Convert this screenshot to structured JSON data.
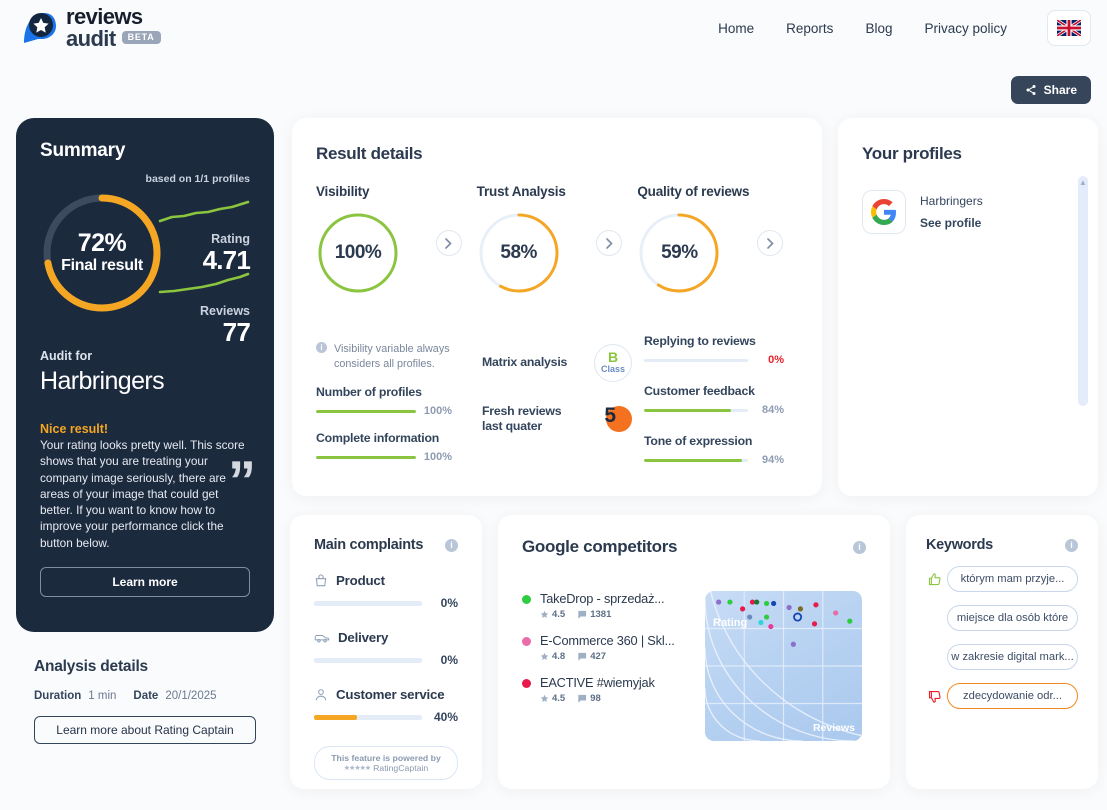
{
  "header": {
    "logo_line1": "reviews",
    "logo_line2": "audit",
    "beta": "BETA",
    "nav": [
      {
        "label": "Home"
      },
      {
        "label": "Reports"
      },
      {
        "label": "Blog"
      },
      {
        "label": "Privacy policy"
      }
    ],
    "language_icon": "uk-flag-icon",
    "share_label": "Share",
    "share_icon": "share-icon"
  },
  "summary": {
    "title": "Summary",
    "based_on": "based on 1/1 profiles",
    "final_percent": 72,
    "final_percent_label": "72%",
    "final_label": "Final result",
    "rating_label": "Rating",
    "rating_value": "4.71",
    "reviews_label": "Reviews",
    "reviews_value": "77",
    "audit_for_label": "Audit for",
    "audit_name": "Harbringers",
    "verdict_title": "Nice result!",
    "verdict_body": "Your rating looks pretty well. This score shows that you are treating your company image seriously, there are areas of your image that could get better. If you want to know how to improve your performance click the button below.",
    "learn_more": "Learn more",
    "accent": "#f5a623"
  },
  "analysis": {
    "title": "Analysis details",
    "duration_label": "Duration",
    "duration_value": "1 min",
    "date_label": "Date",
    "date_value": "20/1/2025",
    "rating_captain_btn": "Learn more about Rating Captain"
  },
  "result_details": {
    "title": "Result details",
    "metrics": [
      {
        "label": "Visibility",
        "value": 100,
        "value_label": "100%",
        "color": "#8bc53f"
      },
      {
        "label": "Trust Analysis",
        "value": 58,
        "value_label": "58%",
        "color": "#f5a623"
      },
      {
        "label": "Quality of reviews",
        "value": 59,
        "value_label": "59%",
        "color": "#f5a623"
      }
    ],
    "visibility_note": "Visibility variable always considers all profiles.",
    "visibility_bars": [
      {
        "label": "Number of profiles",
        "value": 100,
        "value_label": "100%",
        "color": "#8bc53f"
      },
      {
        "label": "Complete information",
        "value": 100,
        "value_label": "100%",
        "color": "#8bc53f"
      }
    ],
    "trust": {
      "matrix_label": "Matrix analysis",
      "matrix_grade": "B",
      "matrix_grade_sub": "Class",
      "fresh_label": "Fresh reviews last quater",
      "fresh_value": "5"
    },
    "quality_bars": [
      {
        "label": "Replying to reviews",
        "value": 0,
        "value_label": "0%",
        "color": "#e8202a",
        "red": true
      },
      {
        "label": "Customer feedback",
        "value": 84,
        "value_label": "84%",
        "color": "#8bc53f",
        "red": false
      },
      {
        "label": "Tone of expression",
        "value": 94,
        "value_label": "94%",
        "color": "#8bc53f",
        "red": false
      }
    ]
  },
  "profiles": {
    "title": "Your profiles",
    "items": [
      {
        "icon": "google-icon",
        "name": "Harbringers",
        "link": "See profile"
      }
    ]
  },
  "complaints": {
    "title": "Main complaints",
    "info_icon": "info-icon",
    "items": [
      {
        "icon": "basket-icon",
        "label": "Product",
        "value": 0,
        "value_label": "0%",
        "color": "#f5a623"
      },
      {
        "icon": "truck-icon",
        "label": "Delivery",
        "value": 0,
        "value_label": "0%",
        "color": "#f5a623"
      },
      {
        "icon": "person-icon",
        "label": "Customer service",
        "value": 40,
        "value_label": "40%",
        "color": "#f5a623"
      }
    ],
    "powered_line1": "This feature is powered by",
    "powered_stars": "★★★★★",
    "powered_brand": "RatingCaptain"
  },
  "competitors": {
    "title": "Google competitors",
    "info_icon": "info-icon",
    "items": [
      {
        "name": "TakeDrop - sprzedaż...",
        "rating": "4.5",
        "reviews": "1381",
        "color": "#2ecc40"
      },
      {
        "name": "E-Commerce 360 | Skl...",
        "rating": "4.8",
        "reviews": "427",
        "color": "#e86ca8"
      },
      {
        "name": "EACTIVE #wiemyjak",
        "rating": "4.5",
        "reviews": "98",
        "color": "#e8194b"
      }
    ],
    "axis_y": "Rating",
    "axis_x": "Reviews"
  },
  "chart_data": {
    "type": "scatter",
    "title": "Google competitors",
    "xlabel": "Reviews",
    "ylabel": "Rating",
    "xlim": [
      0,
      100
    ],
    "ylim": [
      0,
      100
    ],
    "grid": true,
    "points": [
      {
        "x": 4,
        "y": 97,
        "color": "#8e6ecb"
      },
      {
        "x": 12,
        "y": 97,
        "color": "#2ecc40"
      },
      {
        "x": 21,
        "y": 92,
        "color": "#e8194b"
      },
      {
        "x": 28,
        "y": 97,
        "color": "#e8194b"
      },
      {
        "x": 31,
        "y": 97,
        "color": "#1a7a2e"
      },
      {
        "x": 38,
        "y": 96,
        "color": "#2ecc40"
      },
      {
        "x": 43,
        "y": 96,
        "color": "#1744b5"
      },
      {
        "x": 54,
        "y": 93,
        "color": "#8e6ecb"
      },
      {
        "x": 62,
        "y": 92,
        "color": "#7a6a22"
      },
      {
        "x": 73,
        "y": 95,
        "color": "#e8194b"
      },
      {
        "x": 26,
        "y": 86,
        "color": "#6b8bbf"
      },
      {
        "x": 38,
        "y": 86,
        "color": "#2ecc40"
      },
      {
        "x": 34,
        "y": 82,
        "color": "#2fd6d6"
      },
      {
        "x": 41,
        "y": 79,
        "color": "#e8399b"
      },
      {
        "x": 72,
        "y": 81,
        "color": "#e8194b"
      },
      {
        "x": 60,
        "y": 86,
        "color": "#ffffff"
      },
      {
        "x": 87,
        "y": 89,
        "color": "#e86ca8"
      },
      {
        "x": 97,
        "y": 83,
        "color": "#2ecc40"
      },
      {
        "x": 57,
        "y": 66,
        "color": "#8e6ecb"
      }
    ],
    "highlight": {
      "x": 60,
      "y": 86,
      "label": "Harbringers"
    }
  },
  "keywords": {
    "title": "Keywords",
    "info_icon": "info-icon",
    "items": [
      {
        "text": "którym mam przyje...",
        "sentiment": "positive",
        "icon": "thumb-up-icon"
      },
      {
        "text": "miejsce dla osób które",
        "sentiment": "neutral",
        "icon": ""
      },
      {
        "text": "w zakresie digital mark...",
        "sentiment": "neutral",
        "icon": ""
      },
      {
        "text": "zdecydowanie odr...",
        "sentiment": "negative",
        "icon": "thumb-down-icon"
      }
    ]
  }
}
